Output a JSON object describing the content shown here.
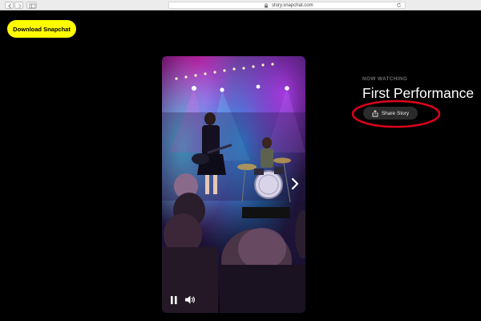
{
  "browser": {
    "url": "story.snapchat.com",
    "icons": [
      "back-icon",
      "forward-icon",
      "sidebar-icon",
      "lock-icon",
      "reload-icon"
    ]
  },
  "header": {
    "download_label": "Download Snapchat",
    "download_color": "#fffc00"
  },
  "story": {
    "now_watching_label": "NOW WATCHING",
    "title": "First Performance",
    "share_label": "Share Story",
    "share_icon": "share-icon"
  },
  "player": {
    "controls": [
      "pause-icon",
      "volume-icon"
    ],
    "next_icon": "chevron-right-icon"
  },
  "annotation": {
    "color": "#e0001b",
    "shape": "ellipse"
  }
}
